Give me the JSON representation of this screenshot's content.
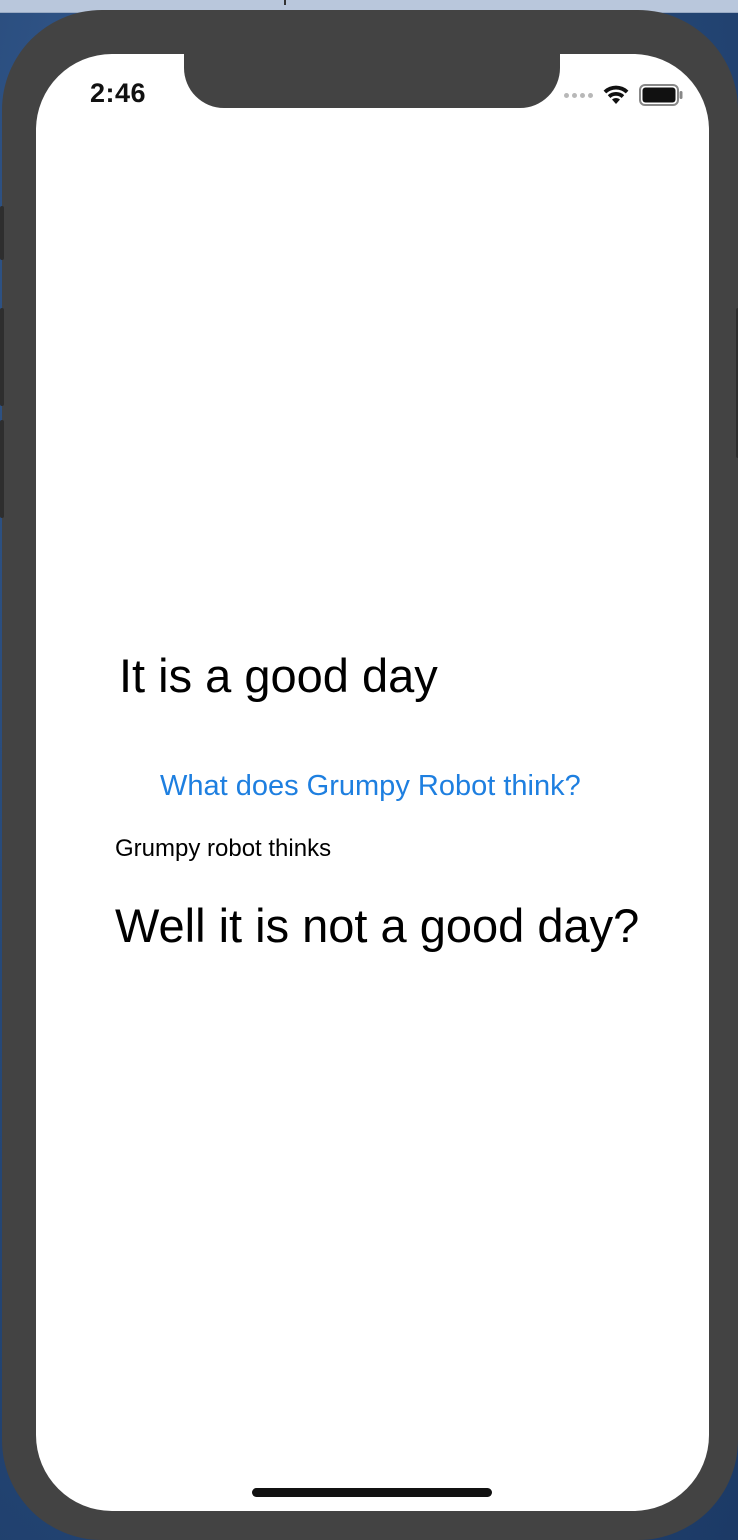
{
  "status_bar": {
    "time": "2:46",
    "icons": [
      "signal-dots-icon",
      "wifi-icon",
      "battery-icon"
    ]
  },
  "main": {
    "headline": "It is a good day",
    "action_button_label": "What does Grumpy Robot think?",
    "caption": "Grumpy robot thinks",
    "response": "Well it is not a good day?"
  },
  "colors": {
    "device_frame": "#434343",
    "screen_background": "#ffffff",
    "link_blue": "#1e7fe0",
    "text": "#000000"
  }
}
